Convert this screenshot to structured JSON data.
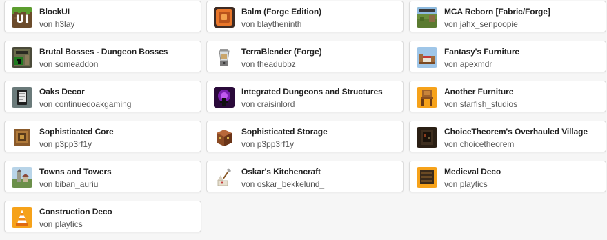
{
  "author_prefix": "von",
  "mods": [
    {
      "name": "BlockUI",
      "author": "h3lay",
      "icon": "blockui-icon"
    },
    {
      "name": "Balm (Forge Edition)",
      "author": "blaytheninth",
      "icon": "balm-icon"
    },
    {
      "name": "MCA Reborn [Fabric/Forge]",
      "author": "jahx_senpoopie",
      "icon": "mca-reborn-icon"
    },
    {
      "name": "Brutal Bosses - Dungeon Bosses",
      "author": "someaddon",
      "icon": "brutal-bosses-icon"
    },
    {
      "name": "TerraBlender (Forge)",
      "author": "theadubbz",
      "icon": "terrablender-icon"
    },
    {
      "name": "Fantasy's Furniture",
      "author": "apexmdr",
      "icon": "fantasys-furniture-icon"
    },
    {
      "name": "Oaks Decor",
      "author": "continuedoakgaming",
      "icon": "oaks-decor-icon"
    },
    {
      "name": "Integrated Dungeons and Structures",
      "author": "craisinlord",
      "icon": "integrated-dungeons-icon"
    },
    {
      "name": "Another Furniture",
      "author": "starfish_studios",
      "icon": "another-furniture-icon"
    },
    {
      "name": "Sophisticated Core",
      "author": "p3pp3rf1y",
      "icon": "sophisticated-core-icon"
    },
    {
      "name": "Sophisticated Storage",
      "author": "p3pp3rf1y",
      "icon": "sophisticated-storage-icon"
    },
    {
      "name": "ChoiceTheorem's Overhauled Village",
      "author": "choicetheorem",
      "icon": "overhauled-village-icon"
    },
    {
      "name": "Towns and Towers",
      "author": "biban_auriu",
      "icon": "towns-and-towers-icon"
    },
    {
      "name": "Oskar's Kitchencraft",
      "author": "oskar_bekkelund_",
      "icon": "kitchencraft-icon"
    },
    {
      "name": "Medieval Deco",
      "author": "playtics",
      "icon": "medieval-deco-icon"
    },
    {
      "name": "Construction Deco",
      "author": "playtics",
      "icon": "construction-deco-icon"
    }
  ]
}
